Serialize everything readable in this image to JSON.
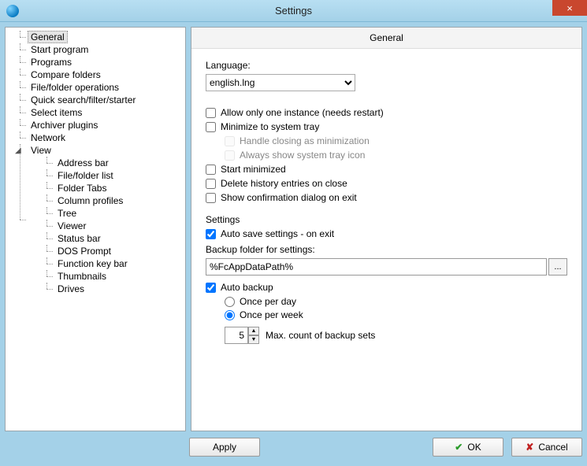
{
  "window": {
    "title": "Settings",
    "close_icon": "×"
  },
  "tree": {
    "items": [
      {
        "label": "General",
        "selected": true
      },
      {
        "label": "Start program"
      },
      {
        "label": "Programs"
      },
      {
        "label": "Compare folders"
      },
      {
        "label": "File/folder operations"
      },
      {
        "label": "Quick search/filter/starter"
      },
      {
        "label": "Select items"
      },
      {
        "label": "Archiver plugins"
      },
      {
        "label": "Network"
      }
    ],
    "view": {
      "label": "View",
      "items": [
        {
          "label": "Address bar"
        },
        {
          "label": "File/folder list"
        },
        {
          "label": "Folder Tabs"
        },
        {
          "label": "Column profiles"
        },
        {
          "label": "Tree"
        },
        {
          "label": "Viewer"
        },
        {
          "label": "Status bar"
        },
        {
          "label": "DOS Prompt"
        },
        {
          "label": "Function key bar"
        },
        {
          "label": "Thumbnails"
        },
        {
          "label": "Drives"
        }
      ]
    }
  },
  "panel": {
    "header": "General",
    "language_label": "Language:",
    "language_value": "english.lng",
    "chk_single_instance": "Allow only one instance (needs restart)",
    "chk_minimize_tray": "Minimize to system tray",
    "chk_handle_closing": "Handle closing as minimization",
    "chk_show_tray_icon": "Always show system tray icon",
    "chk_start_minimized": "Start minimized",
    "chk_delete_history": "Delete history entries on close",
    "chk_confirm_exit": "Show confirmation dialog on exit",
    "settings_label": "Settings",
    "chk_auto_save": "Auto save settings - on exit",
    "backup_folder_label": "Backup folder for settings:",
    "backup_folder_value": "%FcAppDataPath%",
    "browse_btn": "...",
    "chk_auto_backup": "Auto backup",
    "radio_per_day": "Once per day",
    "radio_per_week": "Once per week",
    "spin_value": "5",
    "spin_label": "Max. count of backup sets"
  },
  "buttons": {
    "apply": "Apply",
    "ok": "OK",
    "cancel": "Cancel"
  }
}
